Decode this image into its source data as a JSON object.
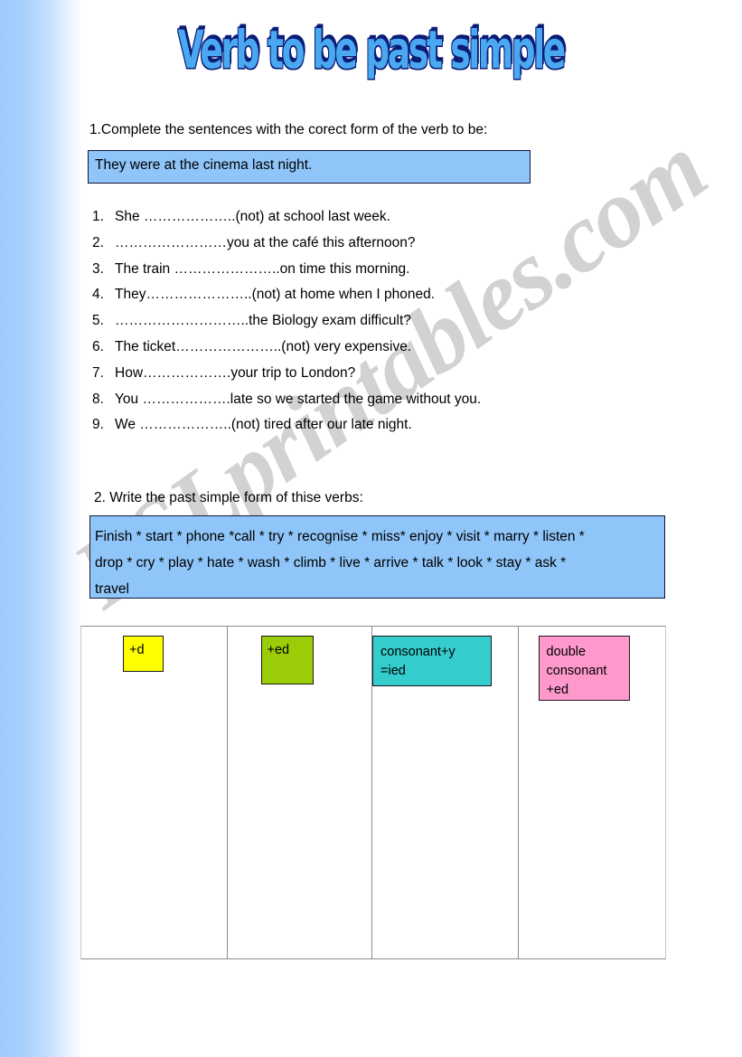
{
  "page": {
    "title": "Verb to be past simple",
    "watermark": "ESLprintables.com",
    "accent_blue": "#8fc5f8",
    "band_blue": "#9fcbfb"
  },
  "exercise1": {
    "prompt": "1.Complete the sentences with the corect form of the verb to be:",
    "example": "They were at the cinema last night.",
    "items": [
      {
        "num": "1.",
        "text": "She ………………..(not) at school last week."
      },
      {
        "num": "2.",
        "text": "……………………you at the café   this afternoon?"
      },
      {
        "num": "3.",
        "text": "The train …………………..on time this morning."
      },
      {
        "num": "4.",
        "text": "They…………………..(not) at home when I phoned."
      },
      {
        "num": "5.",
        "text": "………………………..the Biology exam difficult?"
      },
      {
        "num": "6.",
        "text": "The ticket…………………..(not) very expensive."
      },
      {
        "num": "7.",
        "text": "How……………….your trip to London?"
      },
      {
        "num": "8.",
        "text": "You ……………….late so we started the game without you."
      },
      {
        "num": "9.",
        "text": "We ………………..(not) tired after our late night."
      }
    ]
  },
  "exercise2": {
    "prompt": "2. Write the past simple form of thise verbs:",
    "wordbank_lines": [
      "Finish * start * phone *call * try * recognise * miss* enjoy * visit * marry * listen *",
      "drop  * cry * play * hate * wash * climb * live * arrive * talk * look * stay * ask *",
      "travel"
    ],
    "table": {
      "columns": [
        {
          "tag_lines": [
            "+d"
          ],
          "color": "#ffff00",
          "color_name": "yellow",
          "entries": []
        },
        {
          "tag_lines": [
            "+ed"
          ],
          "color": "#9acd07",
          "color_name": "green",
          "entries": []
        },
        {
          "tag_lines": [
            "consonant+y",
            "=ied"
          ],
          "color": "#34cccc",
          "color_name": "cyan",
          "entries": []
        },
        {
          "tag_lines": [
            "double",
            "consonant",
            "+ed"
          ],
          "color": "#ff99cc",
          "color_name": "pink",
          "entries": []
        }
      ]
    }
  }
}
